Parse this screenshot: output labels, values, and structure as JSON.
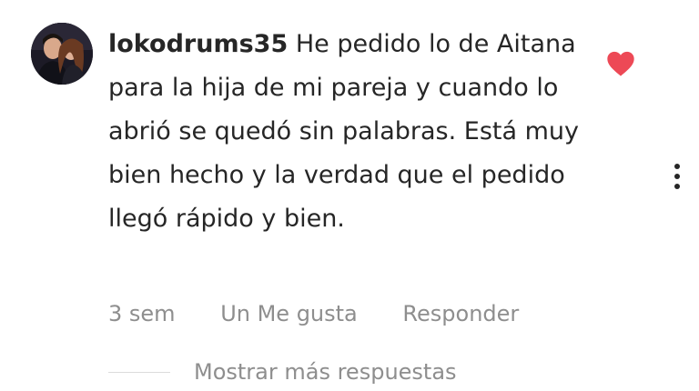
{
  "comment": {
    "avatar_icon": "user-avatar",
    "username": "lokodrums35",
    "text": "He pedido lo de Aitana para la hija de mi pareja y cuando lo abrió se quedó sin palabras. Está muy bien hecho y la verdad que el pedido llegó rápido y bien.",
    "time": "3 sem",
    "likes_label": "Un Me gusta",
    "reply_label": "Responder",
    "like_icon": "heart-filled-icon",
    "like_color": "#ed4956",
    "more_icon": "more-vertical-icon"
  },
  "replies": {
    "label": "Mostrar más respuestas"
  }
}
